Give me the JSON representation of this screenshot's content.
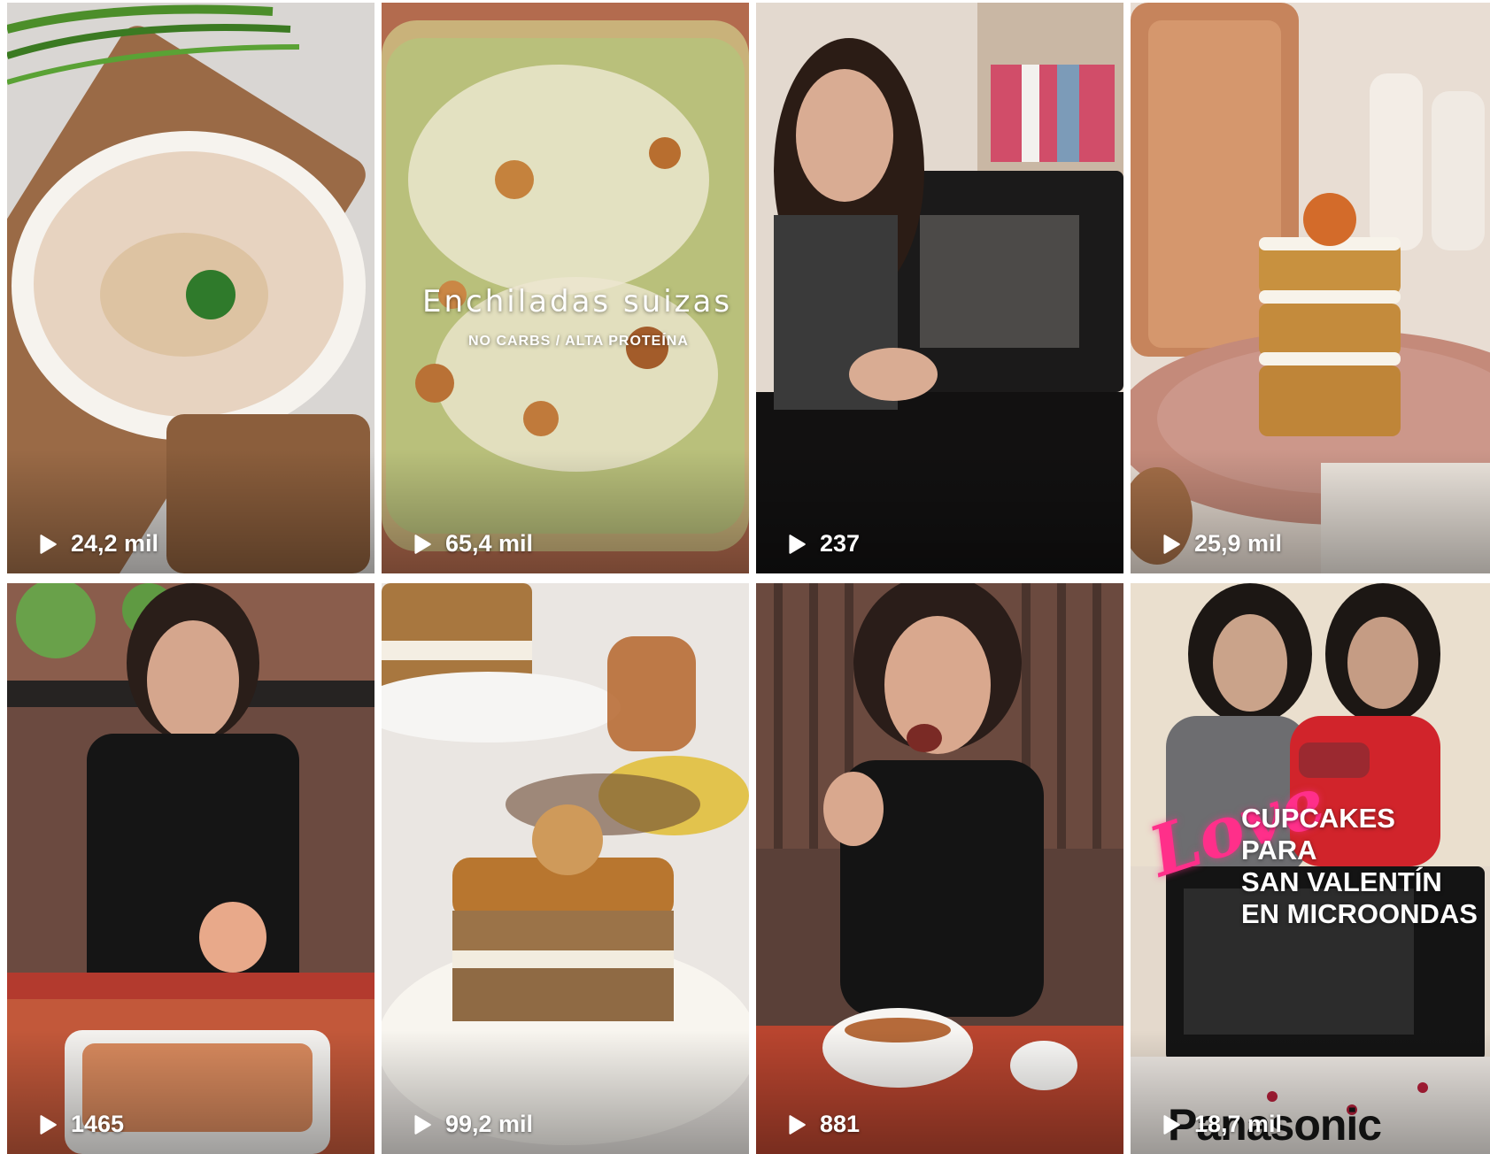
{
  "tiles": [
    {
      "plays": "24,2 mil",
      "thumb_icon": "tuna-dip-thumbnail",
      "colors": {
        "bg": "#7a5236",
        "accent": "#e9d7c6"
      }
    },
    {
      "plays": "65,4 mil",
      "thumb_icon": "enchiladas-thumbnail",
      "overlay_title": "Enchiladas suizas",
      "overlay_subtitle": "NO CARBS / ALTA PROTEÍNA",
      "colors": {
        "bg": "#a7b06b",
        "accent": "#e9e3c9"
      }
    },
    {
      "plays": "237",
      "thumb_icon": "woman-microwave-thumbnail",
      "colors": {
        "bg": "#2a2522",
        "accent": "#d8c3b1"
      }
    },
    {
      "plays": "25,9 mil",
      "thumb_icon": "carrot-cake-thumbnail",
      "colors": {
        "bg": "#c99a7d",
        "accent": "#f2e7de"
      }
    },
    {
      "plays": "1465",
      "thumb_icon": "woman-serving-gratin-thumbnail",
      "colors": {
        "bg": "#5b3d33",
        "accent": "#e6d4c6"
      }
    },
    {
      "plays": "99,2 mil",
      "thumb_icon": "banana-cake-thumbnail",
      "colors": {
        "bg": "#e7e1dc",
        "accent": "#b8773a"
      }
    },
    {
      "plays": "881",
      "thumb_icon": "woman-eating-thumbnail",
      "colors": {
        "bg": "#4a3530",
        "accent": "#d7b7a3"
      }
    },
    {
      "plays": "18,7 mil",
      "thumb_icon": "valentine-cupcakes-thumbnail",
      "overlay_lines": [
        "CUPCAKES",
        "PARA",
        "SAN VALENTÍN",
        "EN MICROONDAS"
      ],
      "overlay_script": "Love",
      "brand": "Panasonic",
      "colors": {
        "bg": "#d9cfc2",
        "accent": "#ff2f8a"
      }
    }
  ]
}
